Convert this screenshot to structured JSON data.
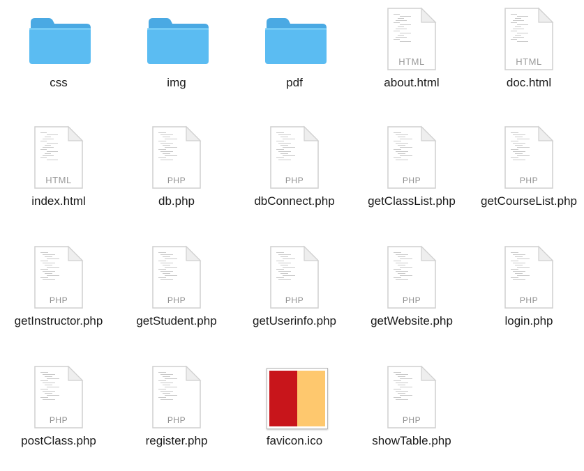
{
  "colors": {
    "folder_front": "#5bbcf2",
    "folder_back": "#4aa9e3",
    "favicon_red": "#c8151b",
    "favicon_yellow": "#fec86e"
  },
  "items": [
    {
      "label": "css",
      "type": "folder",
      "icon": "folder-icon"
    },
    {
      "label": "img",
      "type": "folder",
      "icon": "folder-icon"
    },
    {
      "label": "pdf",
      "type": "folder",
      "icon": "folder-icon"
    },
    {
      "label": "about.html",
      "type": "html",
      "tag": "HTML",
      "icon": "html-file-icon"
    },
    {
      "label": "doc.html",
      "type": "html",
      "tag": "HTML",
      "icon": "html-file-icon"
    },
    {
      "label": "index.html",
      "type": "html",
      "tag": "HTML",
      "icon": "html-file-icon"
    },
    {
      "label": "db.php",
      "type": "php",
      "tag": "PHP",
      "icon": "php-file-icon"
    },
    {
      "label": "dbConnect.php",
      "type": "php",
      "tag": "PHP",
      "icon": "php-file-icon"
    },
    {
      "label": "getClassList.php",
      "type": "php",
      "tag": "PHP",
      "icon": "php-file-icon"
    },
    {
      "label": "getCourseList.php",
      "type": "php",
      "tag": "PHP",
      "icon": "php-file-icon"
    },
    {
      "label": "getInstructor.php",
      "type": "php",
      "tag": "PHP",
      "icon": "php-file-icon"
    },
    {
      "label": "getStudent.php",
      "type": "php",
      "tag": "PHP",
      "icon": "php-file-icon"
    },
    {
      "label": "getUserinfo.php",
      "type": "php",
      "tag": "PHP",
      "icon": "php-file-icon"
    },
    {
      "label": "getWebsite.php",
      "type": "php",
      "tag": "PHP",
      "icon": "php-file-icon"
    },
    {
      "label": "login.php",
      "type": "php",
      "tag": "PHP",
      "icon": "php-file-icon"
    },
    {
      "label": "postClass.php",
      "type": "php",
      "tag": "PHP",
      "icon": "php-file-icon"
    },
    {
      "label": "register.php",
      "type": "php",
      "tag": "PHP",
      "icon": "php-file-icon"
    },
    {
      "label": "favicon.ico",
      "type": "ico",
      "icon": "favicon-image-icon"
    },
    {
      "label": "showTable.php",
      "type": "php",
      "tag": "PHP",
      "icon": "php-file-icon"
    }
  ]
}
